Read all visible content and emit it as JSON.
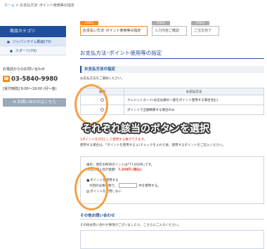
{
  "breadcrumb": {
    "home": "ホーム",
    "separator": ">",
    "current": "お支払方法･ポイント使用等の指定"
  },
  "steps": [
    {
      "tag": "STEP1",
      "label": "お支払い方法･ポイント使用等の指定"
    },
    {
      "tag": "STEP2",
      "label": "入力内容ご確認"
    },
    {
      "tag": "STEP3",
      "label": "ご注文完了"
    }
  ],
  "sidebar": {
    "category_title": "商品カテゴリ",
    "items": [
      {
        "label": "ジャパンライム動画(79)"
      },
      {
        "label": "スポーツ(79)"
      }
    ],
    "contact_label": "お電話からのお問い合わせ",
    "phone": "03-5840-9980",
    "hours": "[受付時間] 9:00～19:00 (月～金)",
    "mail_button": "お問い合わせはこちら"
  },
  "main": {
    "title": "お支払方法･ポイント使用等の指定",
    "payment_section": {
      "heading": "お支払方法の指定",
      "instruction": "お支払方法をご選択ください。",
      "col_select": "選択",
      "col_method": "お支払方法",
      "rows": [
        {
          "label": "クレジットカード(お支払額の一部をポイント使用する場合含む)",
          "selected": false
        },
        {
          "label": "ポイントで全額精算する場合のみ",
          "selected": false
        }
      ]
    },
    "overlay": "それぞれ該当のボタンを選択",
    "note_red": "1ポイントを1円として使用する事ができます。",
    "note_body": "使用する場合は、｢ポイントを使用する｣にチェックを入れた後、使用するポイントをご記入ください。",
    "points": {
      "holder_line": "様の、現在の所持ポイントは｢77,950Pt｣です。",
      "purchase_prefix": "今回ご購入合計金額：",
      "purchase_value": "7,350円 (税込)",
      "opt_use": "ポイントを使用する",
      "opt_amount_prefix": "今回のお買い物で、",
      "opt_amount_suffix": "Ptを使用する。",
      "opt_not_use": "ポイントを使用しない"
    },
    "inquiry": {
      "heading": "その他お問い合わせ",
      "text": "その他お問い合わせ事項がございましたら、こちらにご入力ください。"
    }
  },
  "colors": {
    "accent": "#f08c1a",
    "brand": "#1f4e9b",
    "callout": "#f5a143"
  }
}
